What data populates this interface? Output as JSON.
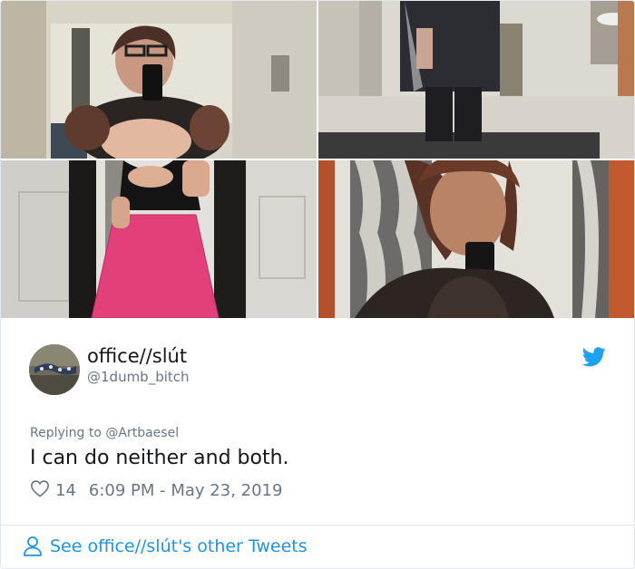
{
  "photos": [
    {
      "name": "mirror-selfie-dorm"
    },
    {
      "name": "mirror-photo-restroom"
    },
    {
      "name": "mirror-photo-pink-skirt"
    },
    {
      "name": "mirror-selfie-closeup"
    }
  ],
  "user": {
    "display_name": "office//slút",
    "handle": "@1dumb_bitch"
  },
  "reply": {
    "prefix": "Replying to",
    "to": "@Artbaesel"
  },
  "tweet": {
    "text": "I can do neither and both.",
    "likes": "14",
    "timestamp": "6:09 PM - May 23, 2019"
  },
  "footer": {
    "see_more": "See office//slút's other Tweets"
  },
  "colors": {
    "twitter_blue": "#1da1f2",
    "link_blue": "#1b95e0",
    "text": "#14171a",
    "muted": "#657786"
  },
  "icons": {
    "bird": "twitter-bird-icon",
    "heart": "heart-icon",
    "person": "person-icon"
  }
}
